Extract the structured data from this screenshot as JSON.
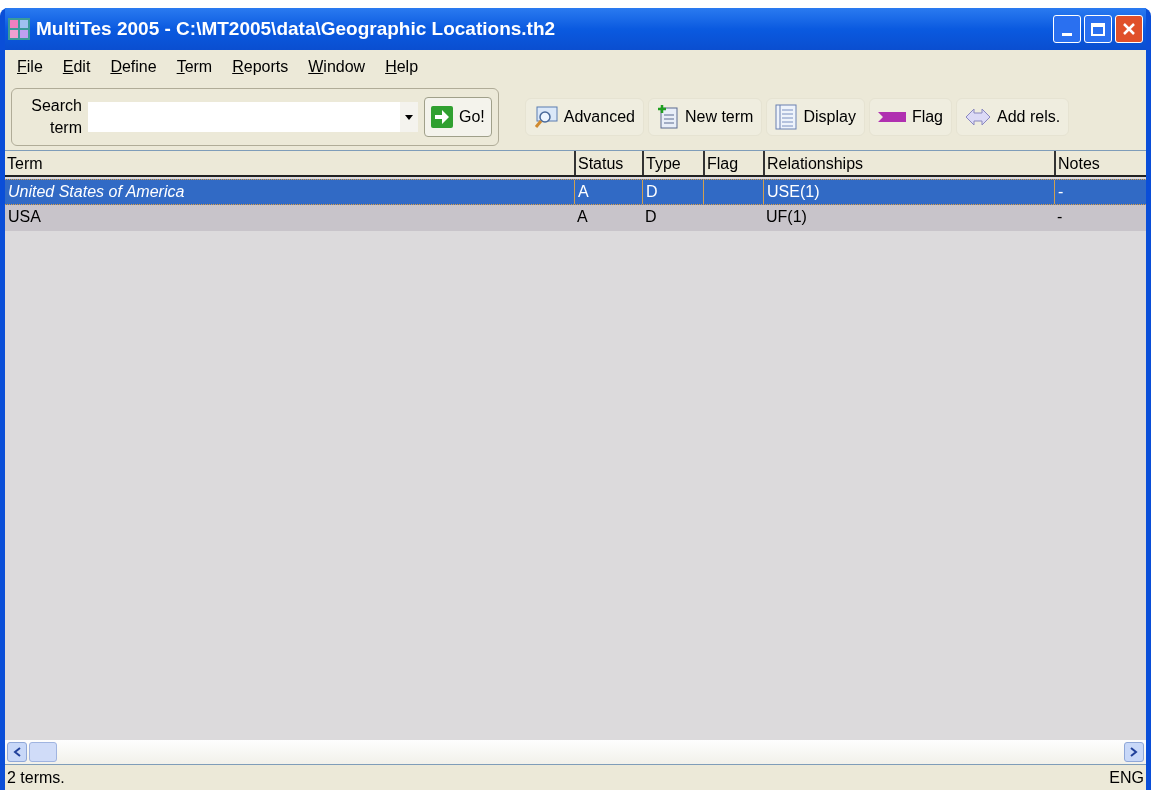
{
  "window": {
    "title": "MultiTes 2005 - C:\\MT2005\\data\\Geographic Locations.th2"
  },
  "menu": [
    "File",
    "Edit",
    "Define",
    "Term",
    "Reports",
    "Window",
    "Help"
  ],
  "search": {
    "label": "Search term",
    "go": "Go!"
  },
  "toolbar": [
    {
      "kind": "advanced",
      "label": "Advanced"
    },
    {
      "kind": "new",
      "label": "New term"
    },
    {
      "kind": "display",
      "label": "Display"
    },
    {
      "kind": "flag",
      "label": "Flag"
    },
    {
      "kind": "rels",
      "label": "Add rels."
    }
  ],
  "table": {
    "columns": [
      "Term",
      "Status",
      "Type",
      "Flag",
      "Relationships",
      "Notes"
    ],
    "rows": [
      {
        "selected": true,
        "preferred": false,
        "cells": [
          "United States of America",
          "A",
          "D",
          null,
          "USE(1)",
          "-"
        ]
      },
      {
        "selected": false,
        "preferred": true,
        "cells": [
          "USA",
          "A",
          "D",
          null,
          "UF(1)",
          "-"
        ]
      }
    ]
  },
  "status_bar": {
    "left": "2 terms.",
    "right": "ENG"
  }
}
